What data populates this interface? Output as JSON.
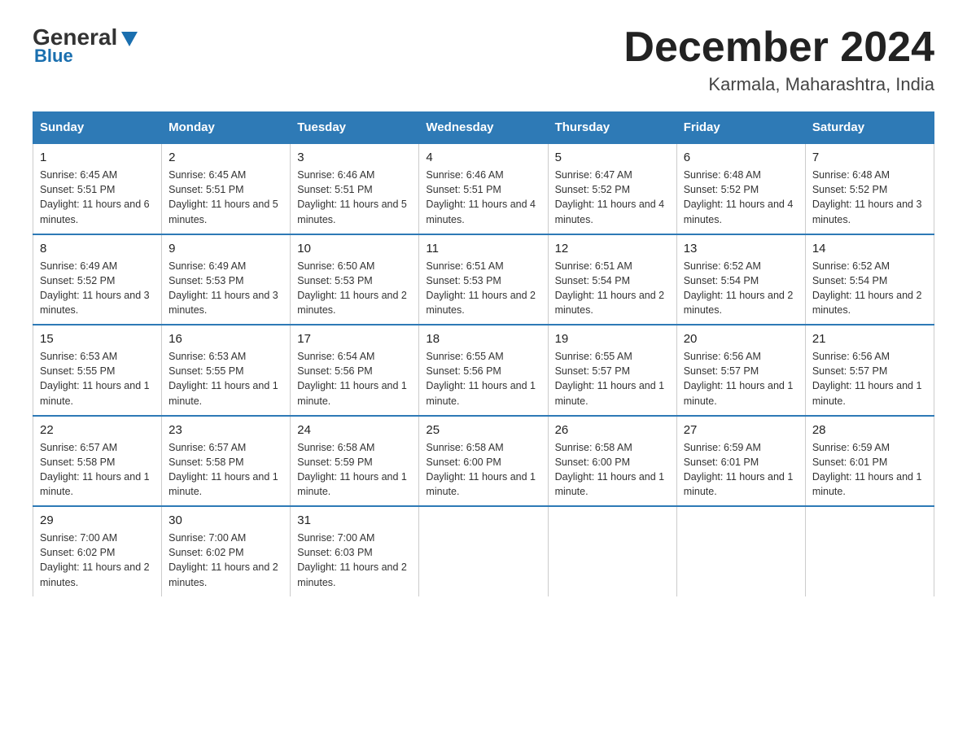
{
  "logo": {
    "general": "General",
    "blue": "Blue",
    "tagline": "Blue"
  },
  "title": "December 2024",
  "subtitle": "Karmala, Maharashtra, India",
  "weekdays": [
    "Sunday",
    "Monday",
    "Tuesday",
    "Wednesday",
    "Thursday",
    "Friday",
    "Saturday"
  ],
  "weeks": [
    [
      {
        "day": "1",
        "sunrise": "6:45 AM",
        "sunset": "5:51 PM",
        "daylight": "11 hours and 6 minutes."
      },
      {
        "day": "2",
        "sunrise": "6:45 AM",
        "sunset": "5:51 PM",
        "daylight": "11 hours and 5 minutes."
      },
      {
        "day": "3",
        "sunrise": "6:46 AM",
        "sunset": "5:51 PM",
        "daylight": "11 hours and 5 minutes."
      },
      {
        "day": "4",
        "sunrise": "6:46 AM",
        "sunset": "5:51 PM",
        "daylight": "11 hours and 4 minutes."
      },
      {
        "day": "5",
        "sunrise": "6:47 AM",
        "sunset": "5:52 PM",
        "daylight": "11 hours and 4 minutes."
      },
      {
        "day": "6",
        "sunrise": "6:48 AM",
        "sunset": "5:52 PM",
        "daylight": "11 hours and 4 minutes."
      },
      {
        "day": "7",
        "sunrise": "6:48 AM",
        "sunset": "5:52 PM",
        "daylight": "11 hours and 3 minutes."
      }
    ],
    [
      {
        "day": "8",
        "sunrise": "6:49 AM",
        "sunset": "5:52 PM",
        "daylight": "11 hours and 3 minutes."
      },
      {
        "day": "9",
        "sunrise": "6:49 AM",
        "sunset": "5:53 PM",
        "daylight": "11 hours and 3 minutes."
      },
      {
        "day": "10",
        "sunrise": "6:50 AM",
        "sunset": "5:53 PM",
        "daylight": "11 hours and 2 minutes."
      },
      {
        "day": "11",
        "sunrise": "6:51 AM",
        "sunset": "5:53 PM",
        "daylight": "11 hours and 2 minutes."
      },
      {
        "day": "12",
        "sunrise": "6:51 AM",
        "sunset": "5:54 PM",
        "daylight": "11 hours and 2 minutes."
      },
      {
        "day": "13",
        "sunrise": "6:52 AM",
        "sunset": "5:54 PM",
        "daylight": "11 hours and 2 minutes."
      },
      {
        "day": "14",
        "sunrise": "6:52 AM",
        "sunset": "5:54 PM",
        "daylight": "11 hours and 2 minutes."
      }
    ],
    [
      {
        "day": "15",
        "sunrise": "6:53 AM",
        "sunset": "5:55 PM",
        "daylight": "11 hours and 1 minute."
      },
      {
        "day": "16",
        "sunrise": "6:53 AM",
        "sunset": "5:55 PM",
        "daylight": "11 hours and 1 minute."
      },
      {
        "day": "17",
        "sunrise": "6:54 AM",
        "sunset": "5:56 PM",
        "daylight": "11 hours and 1 minute."
      },
      {
        "day": "18",
        "sunrise": "6:55 AM",
        "sunset": "5:56 PM",
        "daylight": "11 hours and 1 minute."
      },
      {
        "day": "19",
        "sunrise": "6:55 AM",
        "sunset": "5:57 PM",
        "daylight": "11 hours and 1 minute."
      },
      {
        "day": "20",
        "sunrise": "6:56 AM",
        "sunset": "5:57 PM",
        "daylight": "11 hours and 1 minute."
      },
      {
        "day": "21",
        "sunrise": "6:56 AM",
        "sunset": "5:57 PM",
        "daylight": "11 hours and 1 minute."
      }
    ],
    [
      {
        "day": "22",
        "sunrise": "6:57 AM",
        "sunset": "5:58 PM",
        "daylight": "11 hours and 1 minute."
      },
      {
        "day": "23",
        "sunrise": "6:57 AM",
        "sunset": "5:58 PM",
        "daylight": "11 hours and 1 minute."
      },
      {
        "day": "24",
        "sunrise": "6:58 AM",
        "sunset": "5:59 PM",
        "daylight": "11 hours and 1 minute."
      },
      {
        "day": "25",
        "sunrise": "6:58 AM",
        "sunset": "6:00 PM",
        "daylight": "11 hours and 1 minute."
      },
      {
        "day": "26",
        "sunrise": "6:58 AM",
        "sunset": "6:00 PM",
        "daylight": "11 hours and 1 minute."
      },
      {
        "day": "27",
        "sunrise": "6:59 AM",
        "sunset": "6:01 PM",
        "daylight": "11 hours and 1 minute."
      },
      {
        "day": "28",
        "sunrise": "6:59 AM",
        "sunset": "6:01 PM",
        "daylight": "11 hours and 1 minute."
      }
    ],
    [
      {
        "day": "29",
        "sunrise": "7:00 AM",
        "sunset": "6:02 PM",
        "daylight": "11 hours and 2 minutes."
      },
      {
        "day": "30",
        "sunrise": "7:00 AM",
        "sunset": "6:02 PM",
        "daylight": "11 hours and 2 minutes."
      },
      {
        "day": "31",
        "sunrise": "7:00 AM",
        "sunset": "6:03 PM",
        "daylight": "11 hours and 2 minutes."
      },
      null,
      null,
      null,
      null
    ]
  ],
  "labels": {
    "sunrise": "Sunrise:",
    "sunset": "Sunset:",
    "daylight": "Daylight:"
  }
}
